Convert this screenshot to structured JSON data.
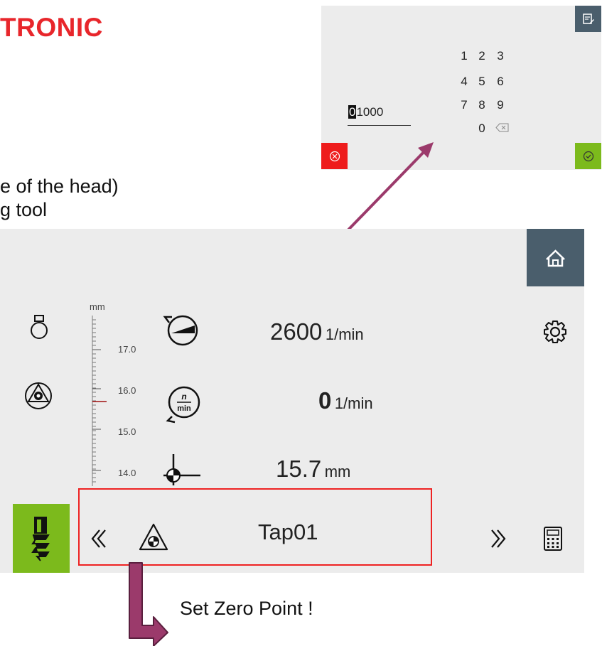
{
  "slide": {
    "title": "TRONIC",
    "bullet_1": "e of the head)",
    "bullet_2": "g tool",
    "callout": "Set Zero Point !"
  },
  "keypad_dialog": {
    "keys": [
      "1",
      "2",
      "3",
      "4",
      "5",
      "6",
      "7",
      "8",
      "9",
      "0"
    ],
    "input_value_first": "0",
    "input_value_rest": "1000",
    "cancel_color": "#ee1c1c",
    "confirm_color": "#7cba1c",
    "header_button_color": "#4a5e6c"
  },
  "main_panel": {
    "scale": {
      "unit": "mm",
      "labels": [
        "17.0",
        "16.0",
        "15.0",
        "14.0"
      ]
    },
    "readouts": {
      "speed_set": {
        "value": "2600",
        "unit": "1/min"
      },
      "speed_actual": {
        "value": "0",
        "unit": "1/min"
      },
      "depth": {
        "value": "15.7",
        "unit": "mm"
      }
    },
    "speed_icon_text": {
      "top": "n",
      "bottom": "min"
    },
    "tool_name": "Tap01",
    "accent_color": "#7cba1c",
    "home_color": "#4a5e6c"
  },
  "icons": [
    "edit-icon",
    "close-circle-icon",
    "check-circle-icon",
    "backspace-icon",
    "home-icon",
    "gear-icon",
    "bell-icon",
    "coolant-icon",
    "spindle-speed-icon",
    "rpm-icon",
    "zero-point-icon",
    "tap-tool-icon",
    "chevron-left-icon",
    "chevron-right-icon",
    "calculator-icon",
    "triangle-zero-icon"
  ]
}
